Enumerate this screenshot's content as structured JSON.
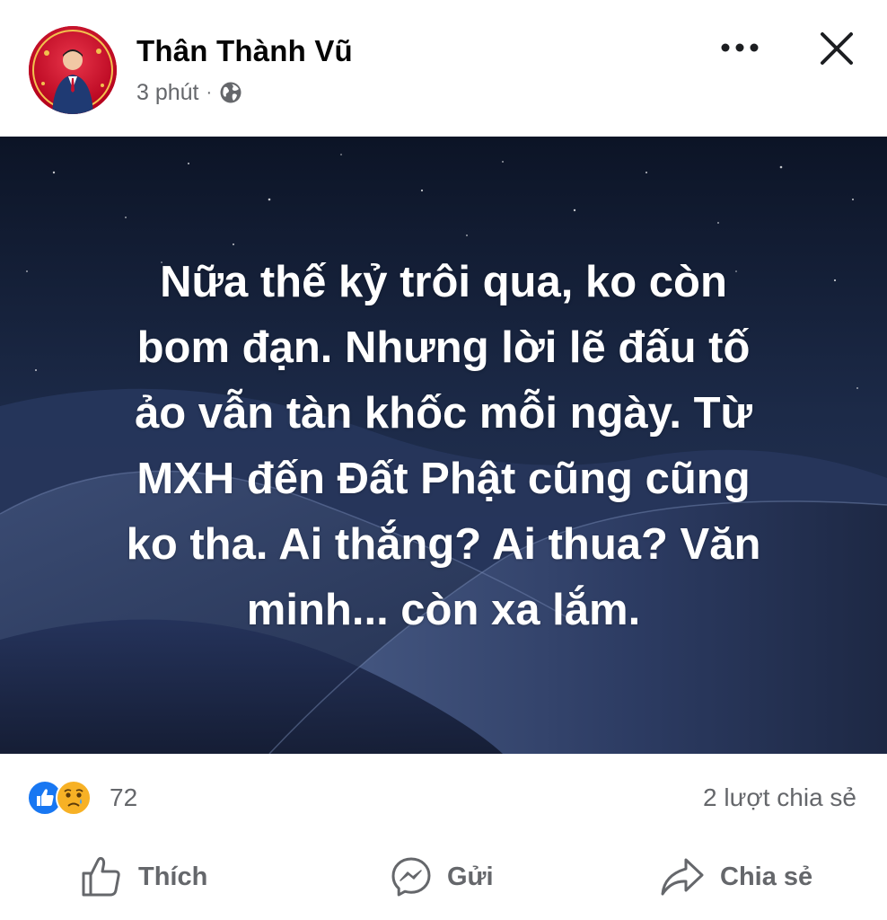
{
  "post": {
    "author": "Thân Thành Vũ",
    "time": "3 phút",
    "separator": "·",
    "privacy_icon": "globe-icon",
    "lines": [
      "Nữa thế kỷ trôi qua, ko còn",
      "bom đạn. Nhưng lời lẽ đấu tố",
      "ảo vẫn tàn khốc mỗi ngày. Từ",
      "MXH đến Đất Phật cũng cũng",
      "ko tha. Ai thắng? Ai thua? Văn",
      "minh... còn xa lắm."
    ]
  },
  "header": {
    "more_icon": "more-icon",
    "close_icon": "close-icon"
  },
  "reactions": {
    "types": [
      "like",
      "sad"
    ],
    "count": "72",
    "shares": "2 lượt chia sẻ"
  },
  "actions": {
    "like_label": "Thích",
    "send_label": "Gửi",
    "share_label": "Chia sẻ"
  },
  "colors": {
    "meta_gray": "#65676b",
    "like_blue": "#1877f2",
    "sad_yellow": "#f7b125",
    "background_night": "#1a2338"
  }
}
